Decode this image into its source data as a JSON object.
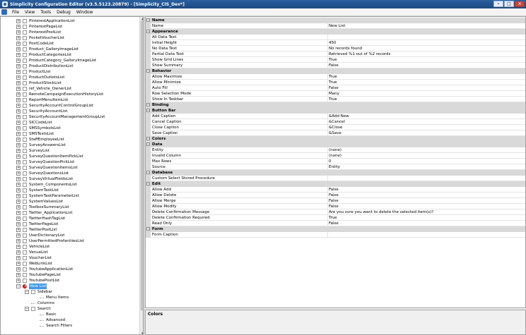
{
  "window": {
    "title": "Simplicity Configuration Editor (v3.5.5123.20879) - [Simplicity_CIS_Dev*]",
    "min": "–",
    "max": "□",
    "close": "×"
  },
  "menu": [
    "File",
    "View",
    "Tools",
    "Debug",
    "Window"
  ],
  "tree": {
    "list_items": [
      "PinterestApplicationList",
      "PinterestPageList",
      "PinterestPostList",
      "PocketVoucherList",
      "PostCodeList",
      "Product_GalleryImageList",
      "ProductCategoriesList",
      "ProductCategory_GalleryImageList",
      "ProductDistributionList",
      "ProductList",
      "ProductOutletsList",
      "ProductStockList",
      "ref_Vehicle_OwnerList",
      "RemoteCampaignExecutionHistoryList",
      "ReportMenuItemList",
      "SecurityAccountControlGroupList",
      "SecurityAccountList",
      "SecurityAccountManagementGroupList",
      "SICCodeList",
      "SMSSymbolsList",
      "SMSTextsList",
      "StaffEmployeeList",
      "SurveyAnswersList",
      "SurveyList",
      "SurveyQuestionItemPickList",
      "SurveyQuestionPickList",
      "SurveyQuestionItemsList",
      "SurveyQuestionsList",
      "SurveyVirtualFieldsList",
      "System_ComponentsList",
      "SystemTaskList",
      "SystemTaskParameterList",
      "SystemValuesList",
      "ToolboxSummaryList",
      "Twitter_ApplicationList",
      "TwitterHashTagList",
      "TwitterPageList",
      "TwitterPostList",
      "UserDictionaryList",
      "UserPermittedProfanitiesList",
      "VehicleList",
      "VenueList",
      "VoucherList",
      "WebLinkList",
      "YoutubeApplicationList",
      "YoutubePageList",
      "YoutubePostList"
    ],
    "new_list": "New List",
    "children": [
      {
        "label": "Sidebar",
        "level": 1,
        "toggle": "−"
      },
      {
        "label": "Menu Items",
        "level": 2,
        "toggle": ""
      },
      {
        "label": "Columns",
        "level": 1,
        "toggle": ""
      },
      {
        "label": "Search",
        "level": 1,
        "toggle": "−"
      },
      {
        "label": "Basic",
        "level": 2,
        "toggle": ""
      },
      {
        "label": "Advanced",
        "level": 2,
        "toggle": ""
      },
      {
        "label": "Search Filters",
        "level": 2,
        "toggle": ""
      }
    ]
  },
  "grid": [
    {
      "type": "cat",
      "name": "Name"
    },
    {
      "type": "prop",
      "name": "Name",
      "value": "New List"
    },
    {
      "type": "cat",
      "name": "Appearance"
    },
    {
      "type": "prop",
      "name": "All Data Text",
      "value": ""
    },
    {
      "type": "prop",
      "name": "Initial Height",
      "value": "450"
    },
    {
      "type": "prop",
      "name": "No Data Text",
      "value": "No records found"
    },
    {
      "type": "prop",
      "name": "Partial Data Text",
      "value": "Retrieved %1 out of %2 records"
    },
    {
      "type": "prop",
      "name": "Show Grid Lines",
      "value": "True"
    },
    {
      "type": "prop",
      "name": "Show Summary",
      "value": "False"
    },
    {
      "type": "cat",
      "name": "Behavior"
    },
    {
      "type": "prop",
      "name": "Allow Maximize",
      "value": "True"
    },
    {
      "type": "prop",
      "name": "Allow Minimize",
      "value": "True"
    },
    {
      "type": "prop",
      "name": "Auto Fill",
      "value": "False"
    },
    {
      "type": "prop",
      "name": "Row Selection Mode",
      "value": "Many"
    },
    {
      "type": "prop",
      "name": "Show In Taskbar",
      "value": "True"
    },
    {
      "type": "cat",
      "name": "Binding"
    },
    {
      "type": "cat",
      "name": "Button Bar"
    },
    {
      "type": "prop",
      "name": "Add Caption",
      "value": "&Add New"
    },
    {
      "type": "prop",
      "name": "Cancel Caption",
      "value": "&Cancel"
    },
    {
      "type": "prop",
      "name": "Close Caption",
      "value": "&Close"
    },
    {
      "type": "prop",
      "name": "Save Caption",
      "value": "&Save"
    },
    {
      "type": "cat",
      "name": "Colors"
    },
    {
      "type": "cat",
      "name": "Data"
    },
    {
      "type": "prop",
      "name": "Entity",
      "value": "(none)"
    },
    {
      "type": "prop",
      "name": "Invalid Column",
      "value": "(none)"
    },
    {
      "type": "prop",
      "name": "Max Rows",
      "value": "0"
    },
    {
      "type": "prop",
      "name": "Source",
      "value": "Entity"
    },
    {
      "type": "cat",
      "name": "Database"
    },
    {
      "type": "prop",
      "name": "Custom Select Stored Procedure",
      "value": ""
    },
    {
      "type": "cat",
      "name": "Edit"
    },
    {
      "type": "prop",
      "name": "Allow Add",
      "value": "False"
    },
    {
      "type": "prop",
      "name": "Allow Delete",
      "value": "False"
    },
    {
      "type": "prop",
      "name": "Allow Merge",
      "value": "False"
    },
    {
      "type": "prop",
      "name": "Allow Modify",
      "value": "False"
    },
    {
      "type": "prop",
      "name": "Delete Confirmation Message",
      "value": "Are you sure you want to delete the selected item(s)?"
    },
    {
      "type": "prop",
      "name": "Delete Confirmation Required",
      "value": "True"
    },
    {
      "type": "prop",
      "name": "Read Only",
      "value": "False"
    },
    {
      "type": "cat",
      "name": "Form"
    },
    {
      "type": "prop",
      "name": "Form Caption",
      "value": ""
    }
  ],
  "description": {
    "title": "Colors"
  }
}
